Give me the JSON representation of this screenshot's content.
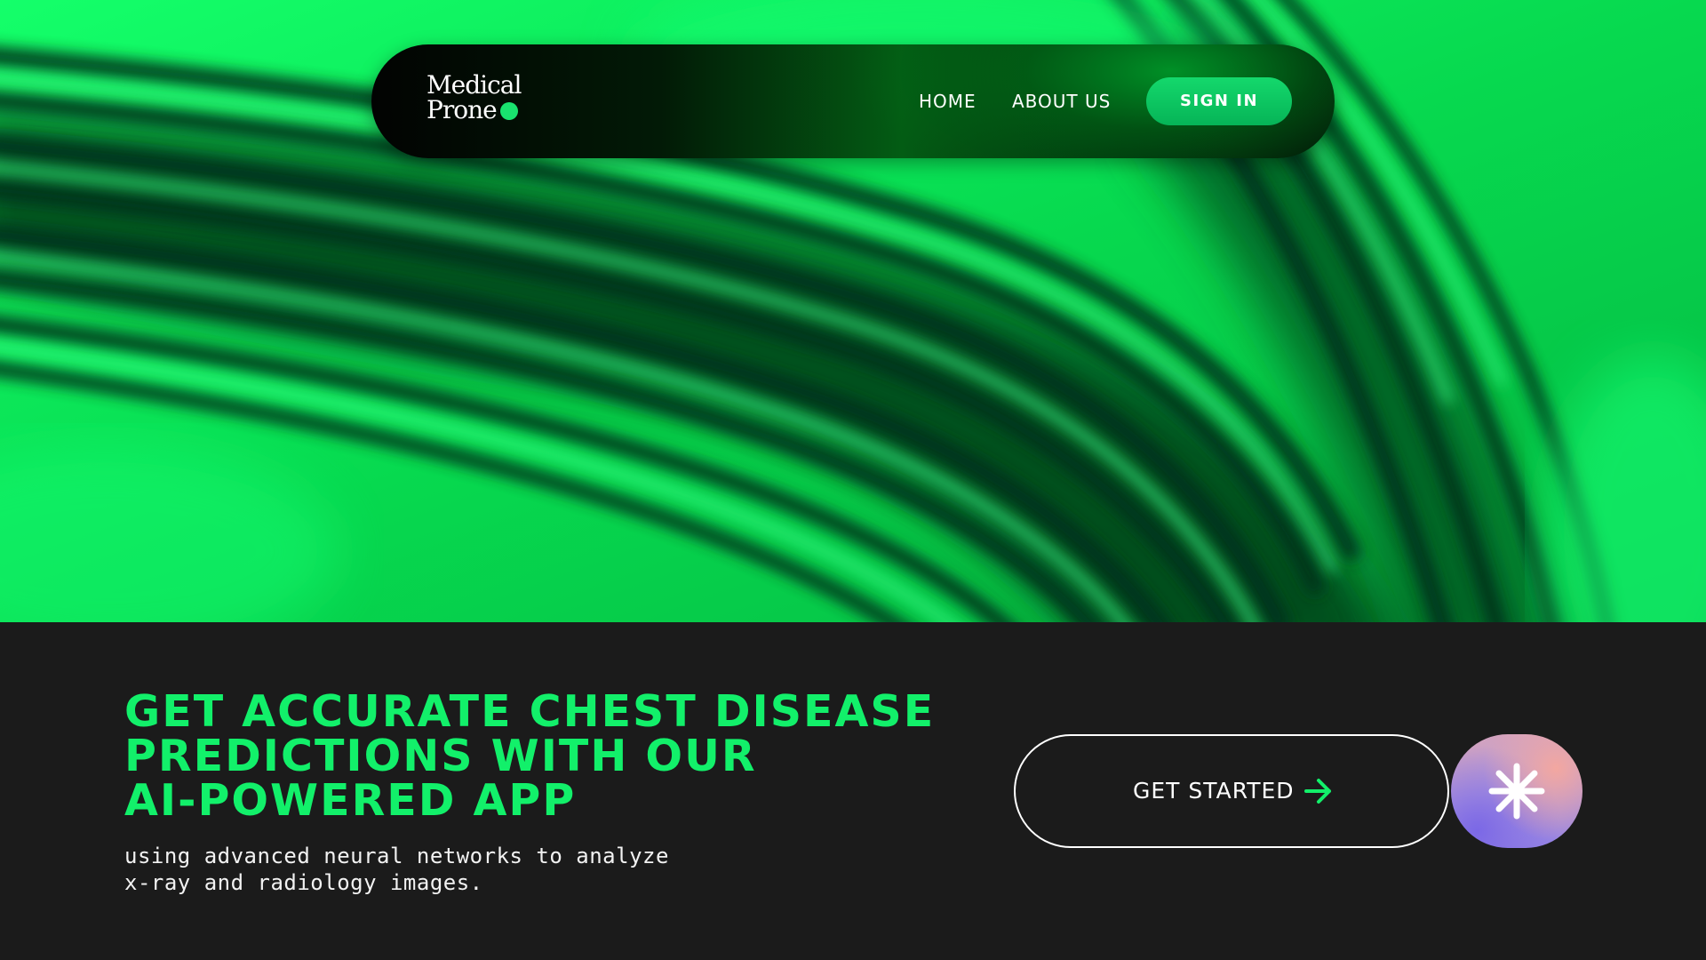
{
  "brand": {
    "name_line1": "Medical",
    "name_line2": "Prone",
    "accent_color": "#19e36f"
  },
  "nav": {
    "items": [
      {
        "label": "HOME"
      },
      {
        "label": "ABOUT US"
      }
    ],
    "signin_label": "SIGN IN"
  },
  "hero": {
    "background": "green-abstract-waves",
    "colors": {
      "bright_green": "#09e45a",
      "dark_green": "#04401a"
    }
  },
  "main": {
    "headline_lines": [
      "GET ACCURATE CHEST DISEASE",
      "PREDICTIONS WITH OUR",
      "AI-POWERED APP"
    ],
    "subtitle_lines": [
      "using advanced neural networks to analyze",
      "x-ray and radiology images."
    ],
    "cta_label": "GET STARTED",
    "cta_icon": "arrow-right-icon",
    "secondary_icon": "asterisk-sparkle-icon",
    "headline_color": "#12f06a",
    "background_color": "#1b1b1b"
  }
}
